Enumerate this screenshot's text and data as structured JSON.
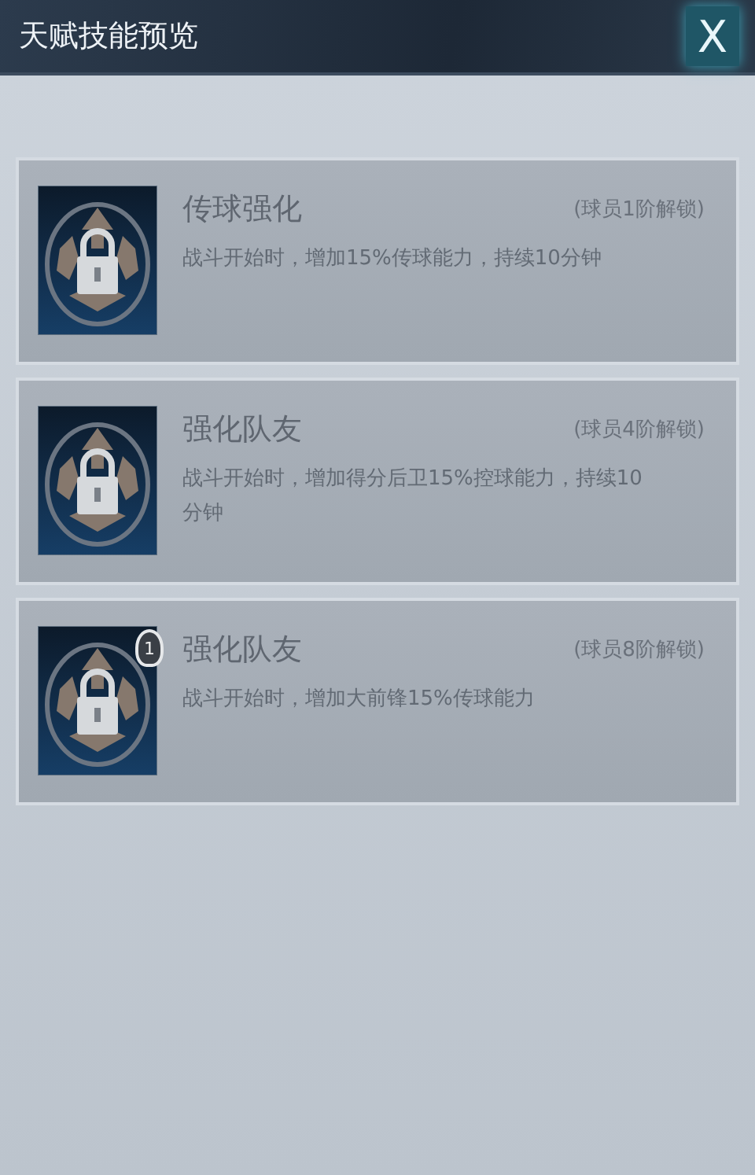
{
  "window": {
    "title": "天赋技能预览",
    "close": "X"
  },
  "skills": [
    {
      "name": "传球强化",
      "unlock": "(球员1阶解锁)",
      "description": "战斗开始时，增加15%传球能力，持续10分钟",
      "locked": true
    },
    {
      "name": "强化队友",
      "unlock": "(球员4阶解锁)",
      "description": "战斗开始时，增加得分后卫15%控球能力，持续10分钟",
      "locked": true
    },
    {
      "name": "强化队友",
      "unlock": "(球员8阶解锁)",
      "description": "战斗开始时，增加大前锋15%传球能力",
      "locked": true,
      "badge": "1"
    }
  ]
}
